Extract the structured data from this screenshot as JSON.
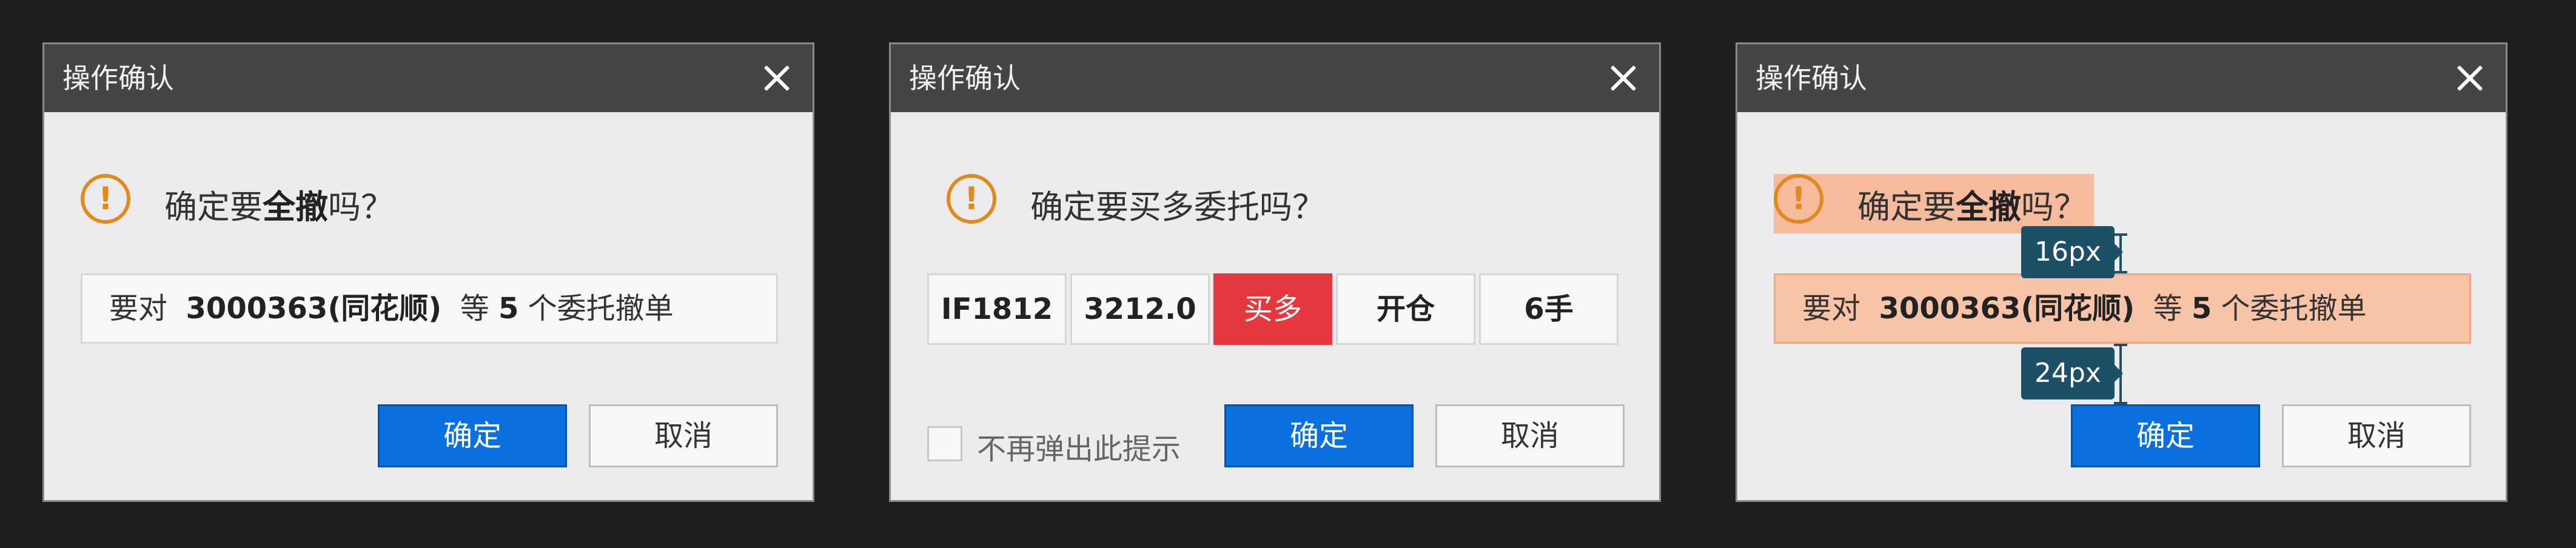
{
  "dialog1": {
    "title": "操作确认",
    "warn_glyph": "!",
    "msg_pre": "确定要",
    "msg_bold": "全撤",
    "msg_post": "吗？",
    "info_pre": "要对",
    "info_code": "3000363(同花顺)",
    "info_mid": "等",
    "info_count": "5",
    "info_post": "个委托撤单",
    "ok_label": "确定",
    "cancel_label": "取消"
  },
  "dialog2": {
    "title": "操作确认",
    "warn_glyph": "!",
    "msg": "确定要买多委托吗？",
    "order": {
      "contract": "IF1812",
      "price": "3212.0",
      "direction": "买多",
      "action": "开仓",
      "quantity": "6手"
    },
    "checkbox_label": "不再弹出此提示",
    "ok_label": "确定",
    "cancel_label": "取消"
  },
  "dialog3": {
    "title": "操作确认",
    "warn_glyph": "!",
    "msg_pre": "确定要",
    "msg_bold": "全撤",
    "msg_post": "吗？",
    "info_pre": "要对",
    "info_code": "3000363(同花顺)",
    "info_mid": "等",
    "info_count": "5",
    "info_post": "个委托撤单",
    "ok_label": "确定",
    "cancel_label": "取消",
    "spacing_top_label": "16px",
    "spacing_bottom_label": "24px"
  },
  "colors": {
    "titlebar": "#454548",
    "primary_button": "#0a70e0",
    "warning": "#e08a1e",
    "buy_direction": "#e6393f",
    "highlight": "#faaa82",
    "measure_badge": "#1d4f67"
  }
}
